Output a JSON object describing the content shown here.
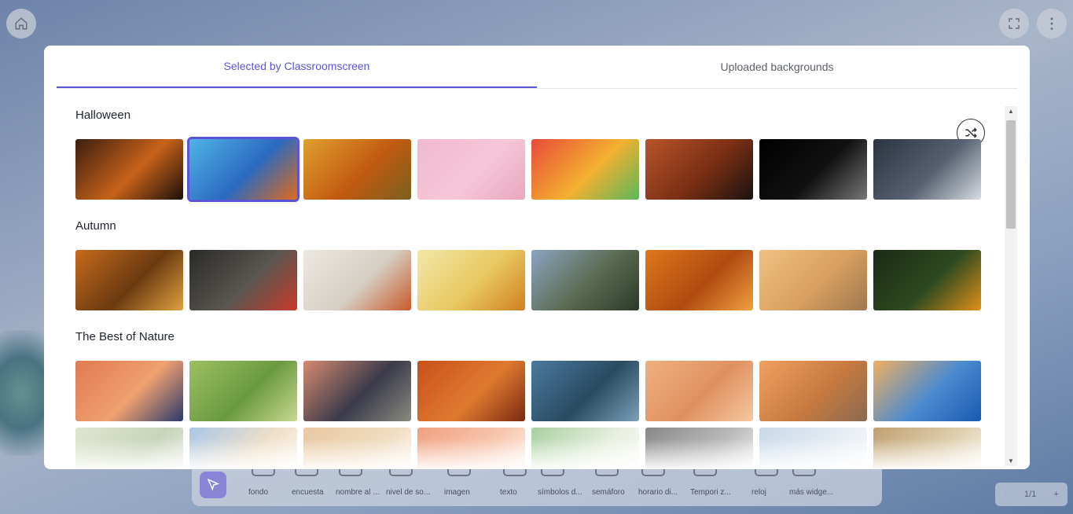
{
  "header": {
    "home_icon": "home-icon",
    "fullscreen_icon": "fullscreen-icon",
    "menu_icon": "more-vertical-icon"
  },
  "modal": {
    "tabs": [
      {
        "label": "Selected by Classroomscreen",
        "active": true
      },
      {
        "label": "Uploaded backgrounds",
        "active": false
      }
    ],
    "shuffle_icon": "shuffle-icon",
    "sections": [
      {
        "title": "Halloween",
        "thumbs": [
          {
            "name": "pumpkins-night-path",
            "colors": [
              "#3a1d10",
              "#c8621a",
              "#1b0f0a"
            ]
          },
          {
            "name": "jack-o-lantern-blue",
            "colors": [
              "#4fb4e6",
              "#2b6ac0",
              "#e06a1a"
            ],
            "selected": true
          },
          {
            "name": "pumpkin-patch",
            "colors": [
              "#e0a030",
              "#c25a10",
              "#7a6020"
            ]
          },
          {
            "name": "candy-pink",
            "colors": [
              "#f1b8cf",
              "#f6c6d8",
              "#e9a6bf"
            ]
          },
          {
            "name": "candy-assortment",
            "colors": [
              "#e84a3a",
              "#f4b030",
              "#5ab85a"
            ]
          },
          {
            "name": "cat-witch-hat",
            "colors": [
              "#b8542a",
              "#7a2e14",
              "#1a1210"
            ]
          },
          {
            "name": "spiderweb-frame",
            "colors": [
              "#000000",
              "#111111",
              "#777777"
            ]
          },
          {
            "name": "full-moon-bats",
            "colors": [
              "#2b3440",
              "#566070",
              "#d8dde2"
            ]
          }
        ]
      },
      {
        "title": "Autumn",
        "thumbs": [
          {
            "name": "maple-leaves",
            "colors": [
              "#c86a1c",
              "#6a3a10",
              "#e0a040"
            ]
          },
          {
            "name": "red-mushroom",
            "colors": [
              "#2a2a28",
              "#5a5650",
              "#c83a2a"
            ]
          },
          {
            "name": "hanging-leaves",
            "colors": [
              "#ece7e0",
              "#d6cfc4",
              "#c85a2a"
            ]
          },
          {
            "name": "autumn-bokeh",
            "colors": [
              "#f2e8a8",
              "#e8c860",
              "#d08020"
            ]
          },
          {
            "name": "yosemite-valley",
            "colors": [
              "#8aa4c0",
              "#5a6a50",
              "#2a3a28"
            ]
          },
          {
            "name": "leaf-veins",
            "colors": [
              "#e0781a",
              "#b04a10",
              "#f0a040"
            ]
          },
          {
            "name": "misty-lake-pier",
            "colors": [
              "#f0c080",
              "#d8a060",
              "#a07850"
            ]
          },
          {
            "name": "forest-mushroom",
            "colors": [
              "#1a2a14",
              "#2e4a20",
              "#e0901a"
            ]
          }
        ]
      },
      {
        "title": "The Best of Nature",
        "thumbs": [
          {
            "name": "mountain-sunset",
            "colors": [
              "#e07a50",
              "#f0a070",
              "#2a3a6a"
            ]
          },
          {
            "name": "green-hills",
            "colors": [
              "#9cc060",
              "#6a9a40",
              "#c8d890"
            ]
          },
          {
            "name": "mount-fuji-dusk",
            "colors": [
              "#d88a70",
              "#3a3a4a",
              "#8a8a80"
            ]
          },
          {
            "name": "antelope-canyon",
            "colors": [
              "#c8501a",
              "#e07a30",
              "#7a2a10"
            ]
          },
          {
            "name": "fjord-river",
            "colors": [
              "#4a7aa0",
              "#2a4a60",
              "#7aa0b8"
            ]
          },
          {
            "name": "desert-dunes",
            "colors": [
              "#f0b080",
              "#e09060",
              "#f4c8a0"
            ]
          },
          {
            "name": "twelve-apostles",
            "colors": [
              "#f0a060",
              "#c87a40",
              "#8a6a50"
            ]
          },
          {
            "name": "blue-ridges",
            "colors": [
              "#f0b060",
              "#4a8ad0",
              "#1a5ab0"
            ]
          }
        ]
      },
      {
        "title": "",
        "thumbs": [
          {
            "name": "row4-1",
            "colors": [
              "#dfe6d0",
              "#c8d4b8",
              "#f2f2f2"
            ]
          },
          {
            "name": "row4-2",
            "colors": [
              "#a8c8e8",
              "#f0e0c8",
              "#ffffff"
            ]
          },
          {
            "name": "row4-3",
            "colors": [
              "#e8c8a0",
              "#f0dcc0",
              "#ffffff"
            ]
          },
          {
            "name": "row4-4",
            "colors": [
              "#f0a080",
              "#f8c8b0",
              "#ffffff"
            ]
          },
          {
            "name": "row4-5",
            "colors": [
              "#a8d0a0",
              "#e8f0e0",
              "#ffffff"
            ]
          },
          {
            "name": "row4-6",
            "colors": [
              "#888888",
              "#bbbbbb",
              "#ffffff"
            ]
          },
          {
            "name": "row4-7",
            "colors": [
              "#c8d8e8",
              "#e8eef4",
              "#ffffff"
            ]
          },
          {
            "name": "row4-8",
            "colors": [
              "#c0a070",
              "#e0d0b0",
              "#ffffff"
            ]
          }
        ]
      }
    ]
  },
  "toolbar": {
    "items": [
      {
        "label": "fondo"
      },
      {
        "label": "encuesta"
      },
      {
        "label": "nombre al ..."
      },
      {
        "label": "nivel de so..."
      },
      {
        "label": "imagen"
      },
      {
        "label": "texto"
      },
      {
        "label": "símbolos d..."
      },
      {
        "label": "semáforo"
      },
      {
        "label": "horario di..."
      },
      {
        "label": "Tempori z..."
      },
      {
        "label": "reloj"
      },
      {
        "label": "más widge..."
      }
    ]
  },
  "pager": {
    "prev": "‹",
    "text": "1/1",
    "next": "+"
  },
  "accent": "#5a55d6"
}
